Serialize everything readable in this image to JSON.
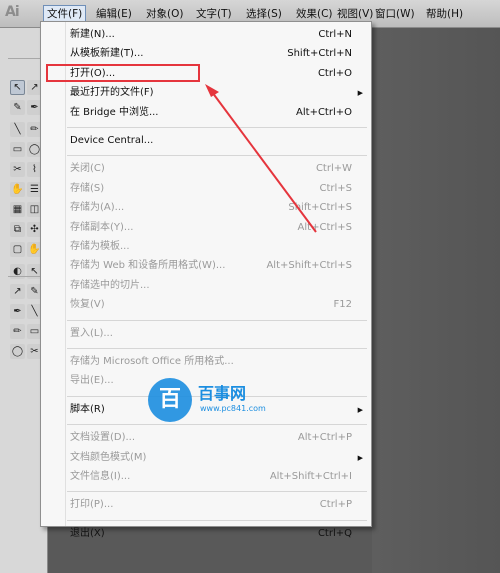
{
  "app": {
    "logo": "Ai"
  },
  "menubar": [
    {
      "label": "文件(F)",
      "active": true
    },
    {
      "label": "编辑(E)"
    },
    {
      "label": "对象(O)"
    },
    {
      "label": "文字(T)"
    },
    {
      "label": "选择(S)"
    },
    {
      "label": "效果(C)"
    },
    {
      "label": "视图(V)"
    },
    {
      "label": "窗口(W)"
    },
    {
      "label": "帮助(H)"
    }
  ],
  "file_menu": [
    {
      "label": "新建(N)...",
      "shortcut": "Ctrl+N",
      "enabled": true
    },
    {
      "label": "从模板新建(T)...",
      "shortcut": "Shift+Ctrl+N",
      "enabled": true
    },
    {
      "label": "打开(O)...",
      "shortcut": "Ctrl+O",
      "enabled": true,
      "highlighted": true
    },
    {
      "label": "最近打开的文件(F)",
      "shortcut": "",
      "enabled": true,
      "submenu": true
    },
    {
      "label": "在 Bridge 中浏览...",
      "shortcut": "Alt+Ctrl+O",
      "enabled": true
    },
    {
      "separator": true
    },
    {
      "label": "Device Central...",
      "shortcut": "",
      "enabled": true
    },
    {
      "separator": true
    },
    {
      "label": "关闭(C)",
      "shortcut": "Ctrl+W",
      "enabled": false
    },
    {
      "label": "存储(S)",
      "shortcut": "Ctrl+S",
      "enabled": false
    },
    {
      "label": "存储为(A)...",
      "shortcut": "Shift+Ctrl+S",
      "enabled": false
    },
    {
      "label": "存储副本(Y)...",
      "shortcut": "Alt+Ctrl+S",
      "enabled": false
    },
    {
      "label": "存储为模板...",
      "shortcut": "",
      "enabled": false
    },
    {
      "label": "存储为 Web 和设备所用格式(W)...",
      "shortcut": "Alt+Shift+Ctrl+S",
      "enabled": false
    },
    {
      "label": "存储选中的切片...",
      "shortcut": "",
      "enabled": false
    },
    {
      "label": "恢复(V)",
      "shortcut": "F12",
      "enabled": false
    },
    {
      "separator": true
    },
    {
      "label": "置入(L)...",
      "shortcut": "",
      "enabled": false
    },
    {
      "separator": true
    },
    {
      "label": "存储为 Microsoft Office 所用格式...",
      "shortcut": "",
      "enabled": false
    },
    {
      "label": "导出(E)...",
      "shortcut": "",
      "enabled": false
    },
    {
      "separator": true
    },
    {
      "label": "脚本(R)",
      "shortcut": "",
      "enabled": true,
      "submenu": true
    },
    {
      "separator": true
    },
    {
      "label": "文档设置(D)...",
      "shortcut": "Alt+Ctrl+P",
      "enabled": false
    },
    {
      "label": "文档颜色模式(M)",
      "shortcut": "",
      "enabled": false,
      "submenu": true
    },
    {
      "label": "文件信息(I)...",
      "shortcut": "Alt+Shift+Ctrl+I",
      "enabled": false
    },
    {
      "separator": true
    },
    {
      "label": "打印(P)...",
      "shortcut": "Ctrl+P",
      "enabled": false
    },
    {
      "separator": true
    },
    {
      "label": "退出(X)",
      "shortcut": "Ctrl+Q",
      "enabled": true
    }
  ],
  "watermark": {
    "glyph": "百",
    "title": "百事网",
    "url": "www.pc841.com"
  },
  "colors": {
    "highlight_box": "#e5353d",
    "arrow": "#e5353d",
    "watermark": "#1c8ee0"
  }
}
